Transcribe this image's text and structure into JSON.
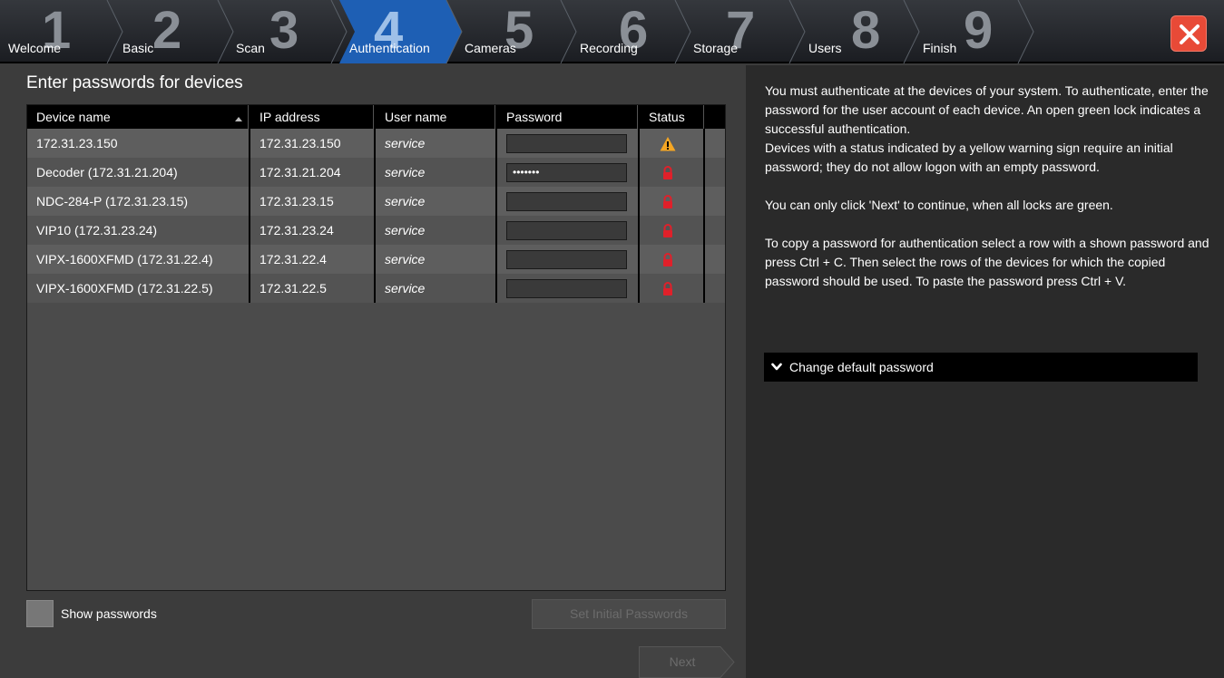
{
  "wizard": {
    "steps": [
      {
        "num": "1",
        "label": "Welcome"
      },
      {
        "num": "2",
        "label": "Basic"
      },
      {
        "num": "3",
        "label": "Scan"
      },
      {
        "num": "4",
        "label": "Authentication"
      },
      {
        "num": "5",
        "label": "Cameras"
      },
      {
        "num": "6",
        "label": "Recording"
      },
      {
        "num": "7",
        "label": "Storage"
      },
      {
        "num": "8",
        "label": "Users"
      },
      {
        "num": "9",
        "label": "Finish"
      }
    ],
    "active_step": "Authentication"
  },
  "main": {
    "title": "Enter passwords for devices",
    "table": {
      "columns": [
        "Device name",
        "IP address",
        "User name",
        "Password",
        "Status"
      ],
      "sort_column": "Device name",
      "rows": [
        {
          "device": "172.31.23.150",
          "ip": "172.31.23.150",
          "user": "service",
          "password": "",
          "status": "warning-icon"
        },
        {
          "device": "Decoder (172.31.21.204)",
          "ip": "172.31.21.204",
          "user": "service",
          "password": "•••••••",
          "status": "lock-icon"
        },
        {
          "device": "NDC-284-P (172.31.23.15)",
          "ip": "172.31.23.15",
          "user": "service",
          "password": "",
          "status": "lock-icon"
        },
        {
          "device": "VIP10 (172.31.23.24)",
          "ip": "172.31.23.24",
          "user": "service",
          "password": "",
          "status": "lock-icon"
        },
        {
          "device": "VIPX-1600XFMD (172.31.22.4)",
          "ip": "172.31.22.4",
          "user": "service",
          "password": "",
          "status": "lock-icon"
        },
        {
          "device": "VIPX-1600XFMD (172.31.22.5)",
          "ip": "172.31.22.5",
          "user": "service",
          "password": "",
          "status": "lock-icon"
        }
      ]
    },
    "show_passwords_label": "Show passwords",
    "set_initial_label": "Set Initial Passwords",
    "next_label": "Next"
  },
  "help": {
    "p1": "You must authenticate at the devices of your system. To authenticate, enter the password for the user account of each device. An open green lock indicates a successful authentication.",
    "p2": "Devices with a status indicated by a yellow warning sign require an initial password; they do not allow logon with an empty password.",
    "p3": "You can only click 'Next' to continue, when all locks are green.",
    "p4": "To copy a password for authentication select a row with a shown password and press Ctrl + C. Then select the rows of the devices for which the copied password should be used. To paste the password press Ctrl + V.",
    "change_default_label": "Change default password"
  },
  "colors": {
    "active_tab": "#1e5fb4",
    "close_button": "#e84a37",
    "warning": "#f5a623",
    "lock": "#e0202a"
  }
}
